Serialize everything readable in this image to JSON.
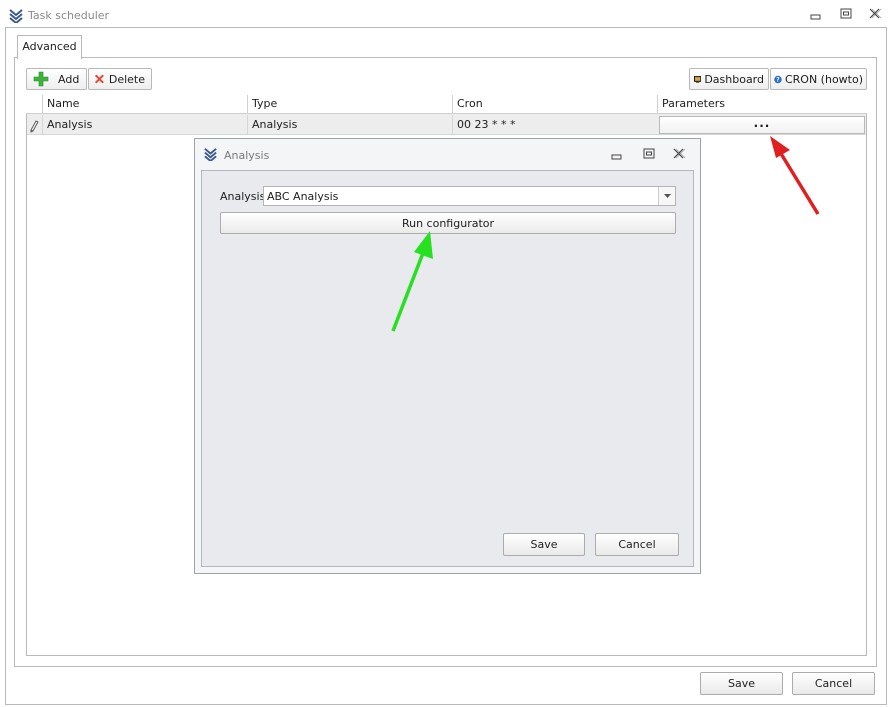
{
  "window": {
    "title": "Task scheduler",
    "controls": [
      "minimize",
      "restore",
      "close"
    ]
  },
  "tabs": [
    {
      "label": "Advanced",
      "active": true
    }
  ],
  "toolbar": {
    "add_label": "Add",
    "delete_label": "Delete",
    "dashboard_label": "Dashboard",
    "cron_label": "CRON (howto)"
  },
  "grid": {
    "columns": [
      "Name",
      "Type",
      "Cron",
      "Parameters"
    ],
    "rows": [
      {
        "name": "Analysis",
        "type": "Analysis",
        "cron": "00 23 * * *",
        "parameters": "..."
      }
    ]
  },
  "dialog": {
    "title": "Analysis",
    "analysis_label": "Analysis",
    "analysis_value": "ABC Analysis",
    "run_configurator_label": "Run configurator",
    "save_label": "Save",
    "cancel_label": "Cancel"
  },
  "footer": {
    "save_label": "Save",
    "cancel_label": "Cancel"
  },
  "colors": {
    "arrow_red": "#e02020",
    "arrow_green": "#27e020",
    "add_icon": "#3cb43c",
    "delete_icon": "#e04a3a",
    "help_icon": "#2a6fc9"
  }
}
